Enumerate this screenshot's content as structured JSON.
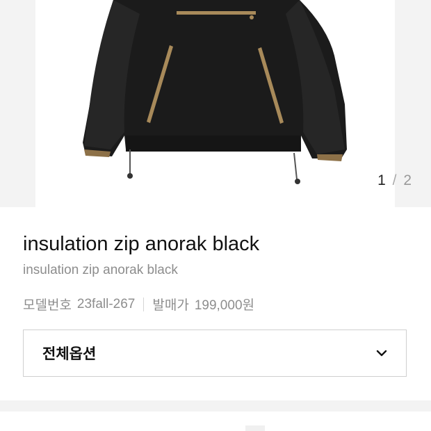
{
  "gallery": {
    "current_page": "1",
    "separator": "/",
    "total_pages": "2"
  },
  "product": {
    "title": "insulation zip anorak black",
    "subtitle": "insulation zip anorak black",
    "model_label": "모델번호",
    "model_value": "23fall-267",
    "release_label": "발매가",
    "release_value": "199,000원"
  },
  "option_select": {
    "label": "전체옵션",
    "icon": "chevron-down-icon"
  },
  "colors": {
    "jacket": "#1b1b1b",
    "zip_trim": "#a88a5a",
    "gallery_bg": "#f3f3f3"
  }
}
